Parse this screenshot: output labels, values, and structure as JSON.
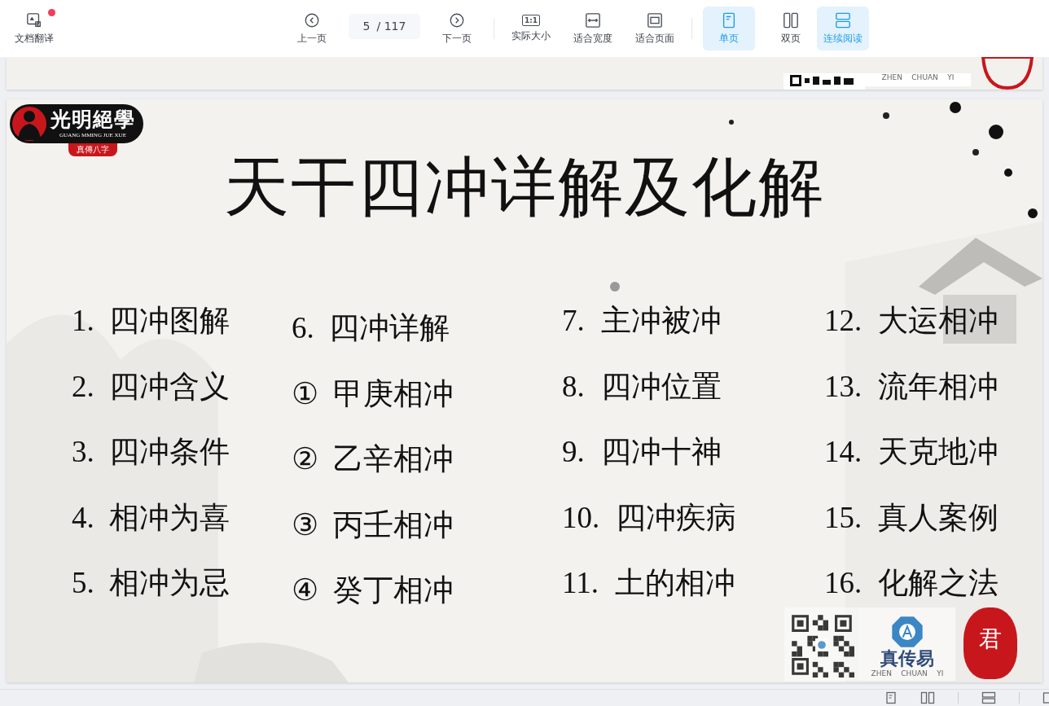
{
  "toolbar": {
    "items": [
      {
        "label": "文档翻译",
        "kind": "tool",
        "badge": true
      },
      {
        "label": "上一页",
        "kind": "nav"
      },
      {
        "kind": "page",
        "value": "5",
        "total": "/ 117"
      },
      {
        "label": "下一页",
        "kind": "nav"
      },
      {
        "label": "实际大小",
        "kind": "zoom",
        "icon_text": "1:1"
      },
      {
        "label": "适合宽度",
        "kind": "zoom"
      },
      {
        "label": "适合页面",
        "kind": "zoom"
      },
      {
        "label": "单页",
        "kind": "view",
        "selected": true
      },
      {
        "label": "双页",
        "kind": "view",
        "selected": false
      },
      {
        "label": "连续阅读",
        "kind": "view",
        "selected": true
      }
    ]
  },
  "previous_page": {
    "brand_sub": "ZHEN    CHUAN    YI"
  },
  "slide": {
    "logo": {
      "title": "光明絕學",
      "subtitle": "GUANG MMING JUE XUE",
      "tag": "真傳八字"
    },
    "title": "天干四冲详解及化解",
    "columns": [
      [
        {
          "number": "1.",
          "text": "四冲图解"
        },
        {
          "number": "2.",
          "text": "四冲含义"
        },
        {
          "number": "3.",
          "text": "四冲条件"
        },
        {
          "number": "4.",
          "text": "相冲为喜"
        },
        {
          "number": "5.",
          "text": "相冲为忌"
        }
      ],
      [
        {
          "number": "6.",
          "text": "四冲详解"
        },
        {
          "number": "①",
          "text": "甲庚相冲"
        },
        {
          "number": "②",
          "text": "乙辛相冲"
        },
        {
          "number": "③",
          "text": "丙壬相冲"
        },
        {
          "number": "④",
          "text": "癸丁相冲"
        }
      ],
      [
        {
          "number": "7.",
          "text": "主冲被冲"
        },
        {
          "number": "8.",
          "text": "四冲位置"
        },
        {
          "number": "9.",
          "text": "四冲十神"
        },
        {
          "number": "10.",
          "text": "四冲疾病"
        },
        {
          "number": "11.",
          "text": "土的相冲"
        }
      ],
      [
        {
          "number": "12.",
          "text": "大运相冲"
        },
        {
          "number": "13.",
          "text": "流年相冲"
        },
        {
          "number": "14.",
          "text": "天克地冲"
        },
        {
          "number": "15.",
          "text": "真人案例"
        },
        {
          "number": "16.",
          "text": "化解之法"
        }
      ]
    ],
    "stamp": {
      "brand": "真传易",
      "brand_sub": "ZHEN    CHUAN    YI",
      "seal": "君"
    }
  }
}
